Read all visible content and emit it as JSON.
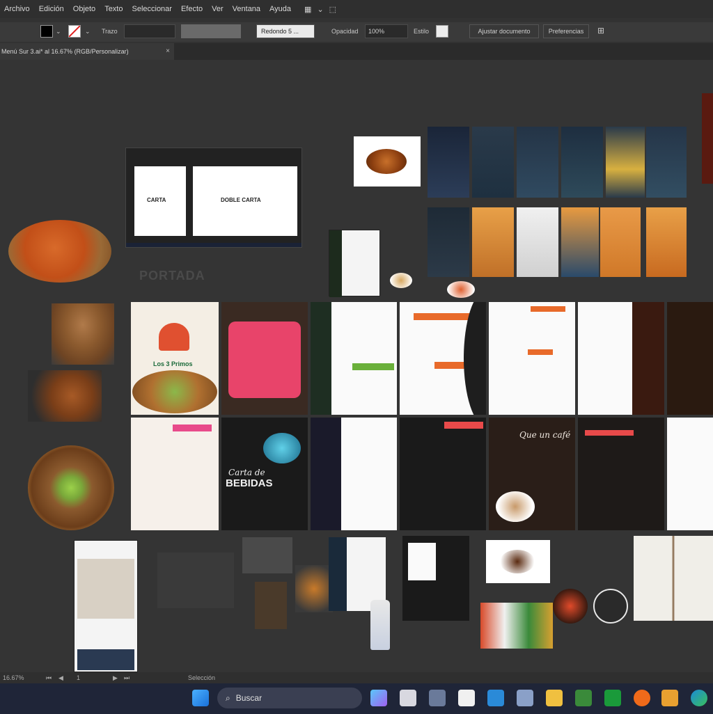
{
  "menubar": {
    "items": [
      "Archivo",
      "Edición",
      "Objeto",
      "Texto",
      "Seleccionar",
      "Efecto",
      "Ver",
      "Ventana",
      "Ayuda"
    ]
  },
  "optionsbar": {
    "stroke_label": "Trazo",
    "brush_label": "Redondo 5 ...",
    "opacity_label": "Opacidad",
    "opacity_value": "100%",
    "style_label": "Estilo",
    "doc_button": "Ajustar documento",
    "prefs_button": "Preferencias"
  },
  "document": {
    "tab_title": "Menú Sur 3.ai* al 16.67% (RGB/Personalizar)",
    "close_glyph": "×"
  },
  "canvas": {
    "board_carta": "CARTA",
    "board_doble": "DOBLE CARTA",
    "portada": "PORTADA",
    "artboard_text": {
      "tres_primos": "Los 3 Primos",
      "carta_de": "Carta de",
      "bebidas": "BEBIDAS",
      "que_un_cafe": "Que un café"
    }
  },
  "statusbar": {
    "zoom": "16.67%",
    "page": "1",
    "tool": "Selección"
  },
  "taskbar": {
    "search_placeholder": "Buscar"
  }
}
